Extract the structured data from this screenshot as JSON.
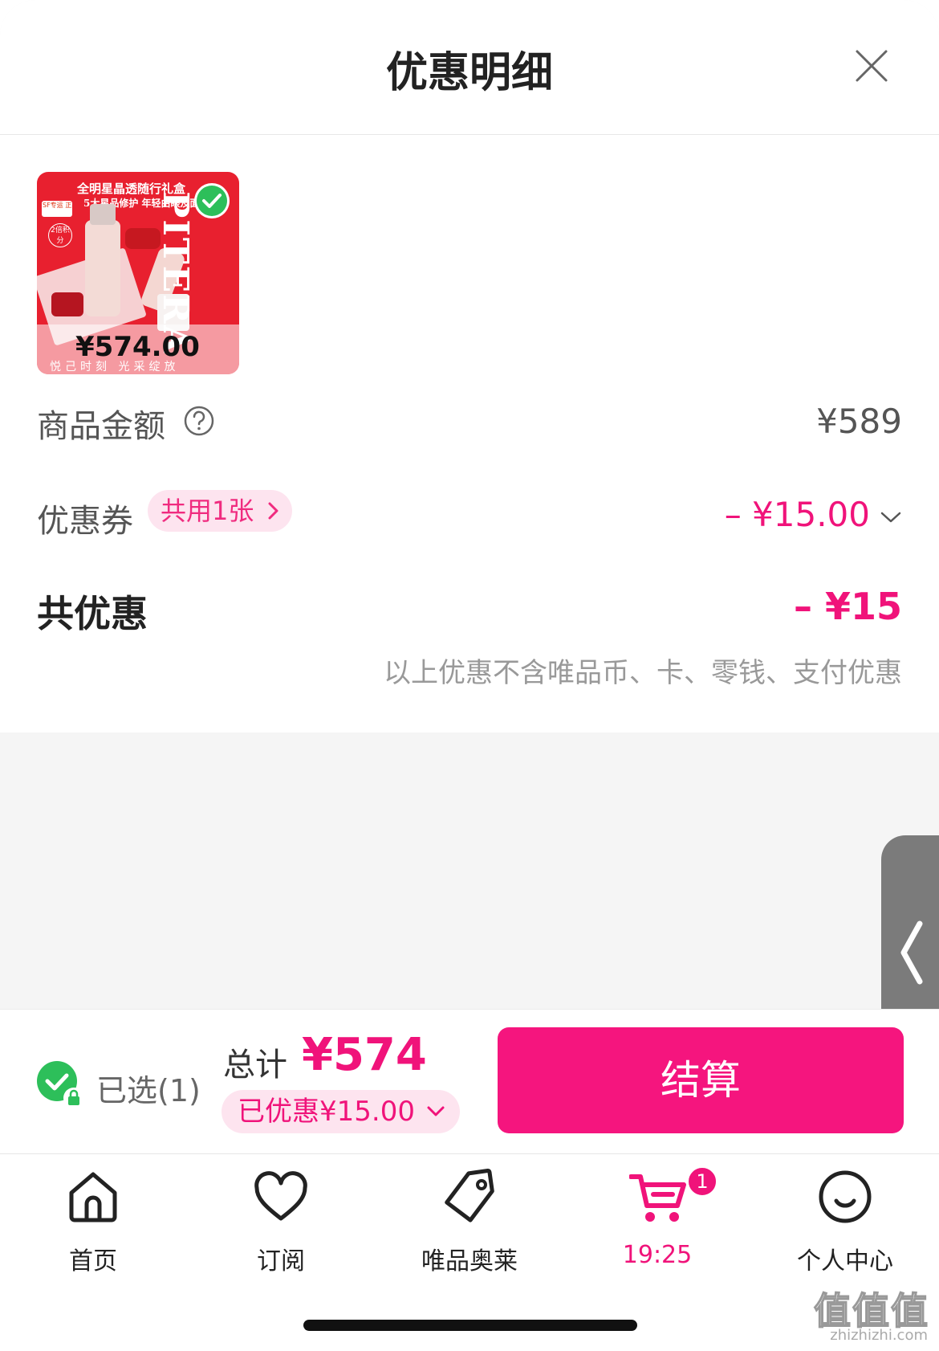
{
  "header": {
    "title": "优惠明细"
  },
  "product": {
    "line1": "全明星晶透随行礼盒",
    "line2": "5大星品修护 年轻由眼及面",
    "sf_tag": "SF专运 正品速达",
    "points_badge": "2倍积分",
    "brand_word": "PITERA",
    "price": "¥574.00",
    "slogan": "悦己时刻 光采绽放"
  },
  "summary": {
    "goods_amount_label": "商品金额",
    "goods_amount_value": "¥589",
    "coupon_label": "优惠券",
    "coupon_pill": "共用1张",
    "coupon_value": "– ¥15.00",
    "total_discount_label": "共优惠",
    "total_discount_value": "– ¥15",
    "note": "以上优惠不含唯品币、卡、零钱、支付优惠"
  },
  "checkout": {
    "selected": "已选(1)",
    "total_label": "总计",
    "total_value": "¥574",
    "discount_pill": "已优惠¥15.00",
    "pay_button": "结算"
  },
  "tabs": [
    {
      "label": "首页",
      "icon": "home-icon"
    },
    {
      "label": "订阅",
      "icon": "heart-icon"
    },
    {
      "label": "唯品奥莱",
      "icon": "tag-icon"
    },
    {
      "label": "19:25",
      "icon": "cart-icon",
      "badge": "1",
      "active": true
    },
    {
      "label": "个人中心",
      "icon": "smiley-icon"
    }
  ],
  "watermark": {
    "main": "值值值",
    "sub": "zhizhizhi.com"
  },
  "colors": {
    "accent": "#f0137a",
    "pill_bg": "#fde4ef",
    "success": "#2dbf5a"
  }
}
